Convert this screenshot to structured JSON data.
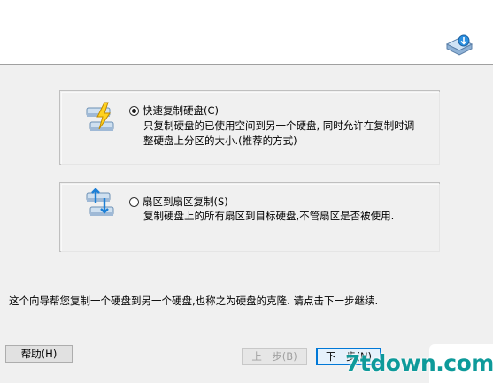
{
  "options": [
    {
      "label": "快速复制硬盘(C)",
      "checked": true,
      "description_lines": [
        "只复制硬盘的已使用空间到另一个硬盘, 同时允许在复制时调",
        "整硬盘上分区的大小.(推荐的方式)"
      ],
      "icon": "fast-copy-disk-icon"
    },
    {
      "label": "扇区到扇区复制(S)",
      "checked": false,
      "description_lines": [
        "复制硬盘上的所有扇区到目标硬盘,不管扇区是否被使用."
      ],
      "icon": "sector-copy-disk-icon"
    }
  ],
  "footer": {
    "description": "这个向导帮您复制一个硬盘到另一个硬盘,也称之为硬盘的克隆. 请点击下一步继续."
  },
  "buttons": {
    "help": "帮助(H)",
    "back": "上一步(B)",
    "next": "下一步(N)"
  },
  "watermark": "7tdown.com",
  "colors": {
    "accent": "#0078d7",
    "watermark": "#0e9a9a"
  }
}
